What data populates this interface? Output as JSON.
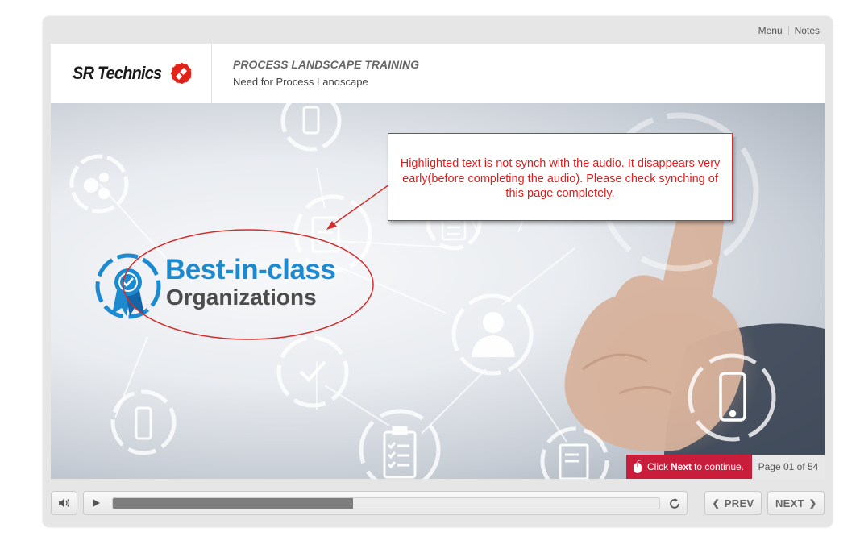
{
  "topnav": {
    "menu": "Menu",
    "notes": "Notes"
  },
  "header": {
    "logo_text": "SR Technics",
    "course_title": "PROCESS LANDSCAPE TRAINING",
    "page_subtitle": "Need for Process Landscape"
  },
  "slide": {
    "brand_line1": "Best-in-class",
    "brand_line2": "Organizations"
  },
  "review_comment": {
    "text": "Highlighted text is not synch with the audio. It disappears very early(before completing the audio). Please check synching of this page completely."
  },
  "footer": {
    "click_prefix": "Click",
    "click_bold": "Next",
    "click_suffix": "to continue.",
    "page_indicator": "Page 01 of 54"
  },
  "controls": {
    "progress": 0.44,
    "prev_label": "PREV",
    "next_label": "NEXT"
  },
  "colors": {
    "accent_red": "#c81e3b",
    "comment_red": "#e21b1b",
    "brand_blue": "#1d8ad0"
  },
  "icons": [
    "gears-icon",
    "phone-icon",
    "document-icon",
    "checklist-icon",
    "user-icon",
    "checkmark-icon",
    "ribbon-badge-icon",
    "mouse-icon",
    "speaker-icon",
    "play-icon",
    "replay-icon",
    "chevron-left-icon",
    "chevron-right-icon"
  ]
}
